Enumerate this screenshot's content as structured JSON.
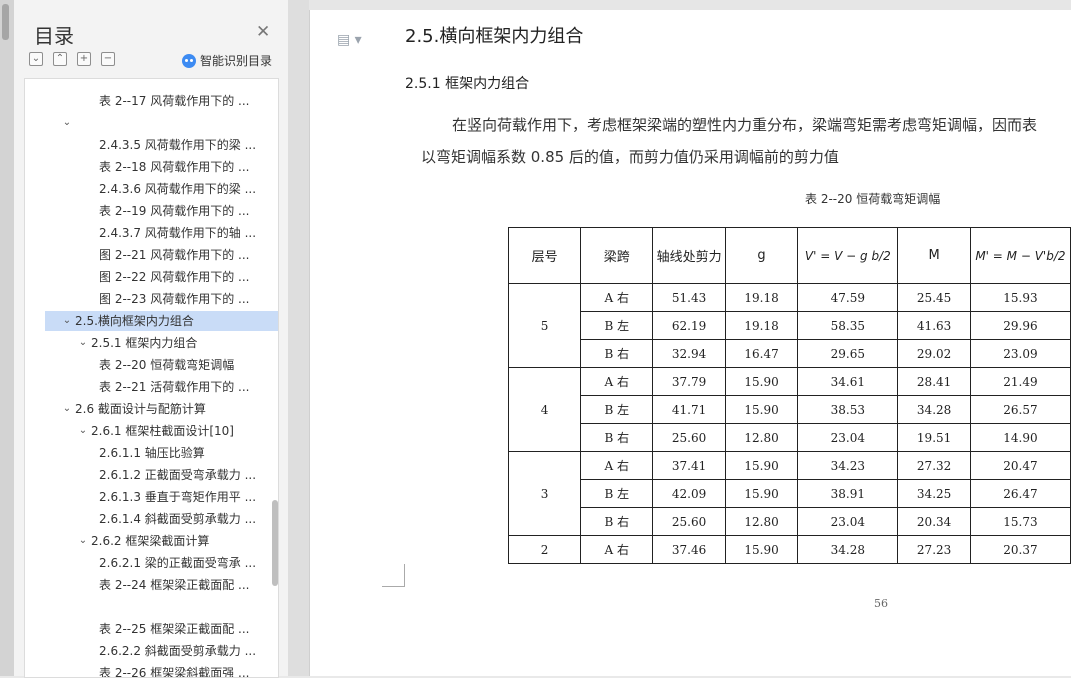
{
  "toc": {
    "title": "目录",
    "smart_label": "智能识别目录",
    "items": [
      {
        "label": "表 2--17 风荷载作用下的 ...",
        "level": 3
      },
      {
        "label": "",
        "level": 1,
        "chevron": "down"
      },
      {
        "label": "2.4.3.5 风荷载作用下的梁 ...",
        "level": 3
      },
      {
        "label": "表 2--18 风荷载作用下的 ...",
        "level": 3
      },
      {
        "label": "2.4.3.6 风荷载作用下的梁 ...",
        "level": 3
      },
      {
        "label": "表 2--19 风荷载作用下的 ...",
        "level": 3
      },
      {
        "label": "2.4.3.7 风荷载作用下的轴 ...",
        "level": 3
      },
      {
        "label": "图 2--21 风荷载作用下的 ...",
        "level": 3
      },
      {
        "label": "图 2--22 风荷载作用下的 ...",
        "level": 3
      },
      {
        "label": "图 2--23 风荷载作用下的 ...",
        "level": 3
      },
      {
        "label": "2.5.横向框架内力组合",
        "level": 1,
        "chevron": "down",
        "selected": true
      },
      {
        "label": "2.5.1 框架内力组合",
        "level": 2,
        "chevron": "down"
      },
      {
        "label": "表 2--20 恒荷载弯矩调幅",
        "level": 3
      },
      {
        "label": "表 2--21 活荷载作用下的 ...",
        "level": 3
      },
      {
        "label": "2.6 截面设计与配筋计算",
        "level": 1,
        "chevron": "down"
      },
      {
        "label": "2.6.1 框架柱截面设计[10]",
        "level": 2,
        "chevron": "down"
      },
      {
        "label": "2.6.1.1 轴压比验算",
        "level": 3
      },
      {
        "label": "2.6.1.2 正截面受弯承载力 ...",
        "level": 3
      },
      {
        "label": "2.6.1.3 垂直于弯矩作用平 ...",
        "level": 3
      },
      {
        "label": "2.6.1.4 斜截面受剪承载力 ...",
        "level": 3
      },
      {
        "label": "2.6.2 框架梁截面计算",
        "level": 2,
        "chevron": "down"
      },
      {
        "label": "2.6.2.1 梁的正截面受弯承 ...",
        "level": 3
      },
      {
        "label": "表 2--24 框架梁正截面配 ...",
        "level": 3
      },
      {
        "label": "",
        "level": 3
      },
      {
        "label": "表 2--25 框架梁正截面配 ...",
        "level": 3
      },
      {
        "label": "2.6.2.2 斜截面受剪承载力 ...",
        "level": 3
      },
      {
        "label": "表 2--26 框架梁斜截面强 ...",
        "level": 3
      }
    ]
  },
  "doc": {
    "heading": "2.5.横向框架内力组合",
    "subheading": "2.5.1 框架内力组合",
    "para_line1": "在竖向荷载作用下，考虑框架梁端的塑性内力重分布，梁端弯矩需考虑弯矩调幅，因而表",
    "para_line2": "以弯矩调幅系数 0.85 后的值，而剪力值仍采用调幅前的剪力值",
    "caption": "表 2--20 恒荷载弯矩调幅",
    "page_number": "56",
    "table": {
      "headers": [
        "层号",
        "梁跨",
        "轴线处剪力",
        "g",
        "V' = V − g b/2",
        "M",
        "M' = M − V'b/2"
      ],
      "groups": [
        {
          "floor": "5",
          "rows": [
            [
              "A 右",
              "51.43",
              "19.18",
              "47.59",
              "25.45",
              "15.93"
            ],
            [
              "B 左",
              "62.19",
              "19.18",
              "58.35",
              "41.63",
              "29.96"
            ],
            [
              "B 右",
              "32.94",
              "16.47",
              "29.65",
              "29.02",
              "23.09"
            ]
          ]
        },
        {
          "floor": "4",
          "rows": [
            [
              "A 右",
              "37.79",
              "15.90",
              "34.61",
              "28.41",
              "21.49"
            ],
            [
              "B 左",
              "41.71",
              "15.90",
              "38.53",
              "34.28",
              "26.57"
            ],
            [
              "B 右",
              "25.60",
              "12.80",
              "23.04",
              "19.51",
              "14.90"
            ]
          ]
        },
        {
          "floor": "3",
          "rows": [
            [
              "A 右",
              "37.41",
              "15.90",
              "34.23",
              "27.32",
              "20.47"
            ],
            [
              "B 左",
              "42.09",
              "15.90",
              "38.91",
              "34.25",
              "26.47"
            ],
            [
              "B 右",
              "25.60",
              "12.80",
              "23.04",
              "20.34",
              "15.73"
            ]
          ]
        },
        {
          "floor": "2",
          "rows": [
            [
              "A 右",
              "37.46",
              "15.90",
              "34.28",
              "27.23",
              "20.37"
            ]
          ]
        }
      ]
    }
  }
}
